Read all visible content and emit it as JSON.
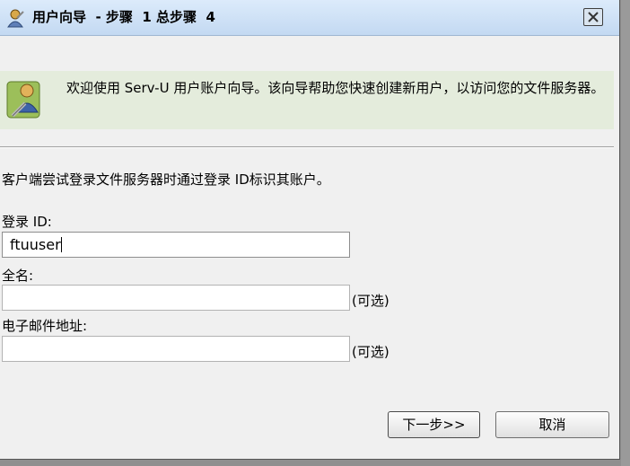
{
  "window": {
    "title": "用户向导  - 步骤  1 总步骤  4"
  },
  "banner": {
    "text": "欢迎使用  Serv-U 用户账户向导。该向导帮助您快速创建新用户，以访问您的文件服务器。"
  },
  "intro": {
    "text": "客户端尝试登录文件服务器时通过登录  ID标识其账户。"
  },
  "fields": {
    "login_id": {
      "label": "登录  ID:",
      "value": "ftuuser"
    },
    "full_name": {
      "label": "全名:",
      "value": "",
      "optional": "(可选)"
    },
    "email": {
      "label": "电子邮件地址:",
      "value": "",
      "optional": "(可选)"
    }
  },
  "buttons": {
    "next": "下一步>>",
    "cancel": "取消"
  },
  "icons": {
    "title": "user-wizard-icon",
    "banner": "user-wizard-icon",
    "close": "close-icon"
  },
  "colors": {
    "titlebar": "#c9ddf4",
    "banner": "#e4ecdc",
    "dialog": "#f0f0f0"
  }
}
